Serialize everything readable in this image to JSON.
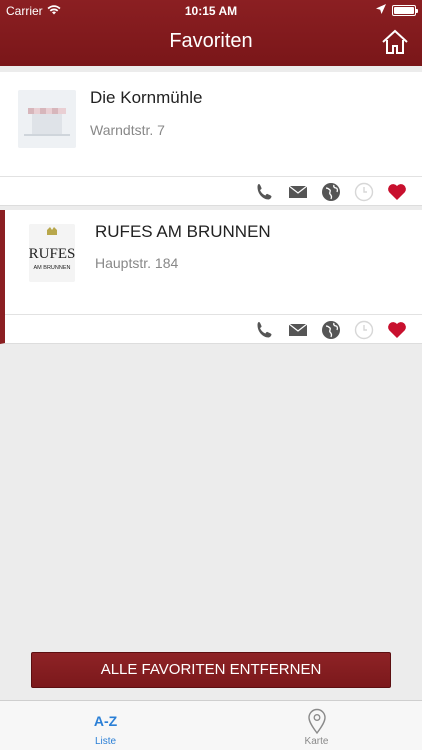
{
  "status_bar": {
    "carrier": "Carrier",
    "time": "10:15 AM"
  },
  "header": {
    "title": "Favoriten"
  },
  "favorites": [
    {
      "name": "Die Kornmühle",
      "address": "Warndtstr. 7"
    },
    {
      "name": "RUFES AM BRUNNEN",
      "address": "Hauptstr. 184",
      "logo_text_1": "RUFES",
      "logo_text_2": "AM BRUNNEN"
    }
  ],
  "actions": {
    "remove_all_label": "ALLE FAVORITEN ENTFERNEN"
  },
  "tabs": [
    {
      "icon_text": "A-Z",
      "label": "Liste"
    },
    {
      "label": "Karte"
    }
  ],
  "colors": {
    "brand": "#8b1f22",
    "tab_active": "#2a7fd6",
    "heart": "#c8102e"
  }
}
